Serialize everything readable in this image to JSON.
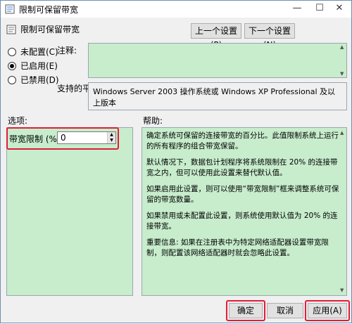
{
  "window": {
    "title": "限制可保留带宽",
    "header": "限制可保留带宽",
    "minimize": "—",
    "maximize": "☐",
    "close": "✕"
  },
  "nav": {
    "prev": "上一个设置(P)",
    "next": "下一个设置(N)"
  },
  "state": {
    "options": [
      {
        "label": "未配置(C)",
        "checked": false
      },
      {
        "label": "已启用(E)",
        "checked": true
      },
      {
        "label": "已禁用(D)",
        "checked": false
      }
    ]
  },
  "comment": {
    "label": "注释:",
    "value": ""
  },
  "platform": {
    "label": "支持的平台:",
    "value": "Windows Server 2003 操作系统或 Windows XP Professional 及以上版本"
  },
  "options_section": {
    "label": "选项:",
    "bandwidth_label": "带宽限制 (%):",
    "bandwidth_value": "0"
  },
  "help": {
    "label": "帮助:",
    "paragraphs": [
      "确定系统可保留的连接带宽的百分比。此值限制系统上运行的所有程序的组合带宽保留。",
      "默认情况下，数据包计划程序将系统限制在 20% 的连接带宽之内，但可以使用此设置来替代默认值。",
      "如果启用此设置，则可以使用“带宽限制”框来调整系统可保留的带宽数量。",
      "如果禁用或未配置此设置，则系统使用默认值为 20% 的连接带宽。",
      "重要信息: 如果在注册表中为特定网络适配器设置带宽限制，则配置该网络适配器时就会忽略此设置。"
    ]
  },
  "buttons": {
    "ok": "确定",
    "cancel": "取消",
    "apply": "应用(A)"
  },
  "colors": {
    "panel_green": "#c7edcc",
    "highlight_red": "#e21c3a"
  }
}
